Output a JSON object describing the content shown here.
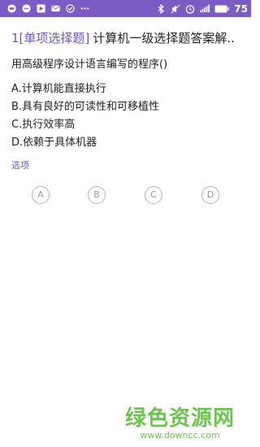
{
  "status_bar": {
    "left_icons": [
      "message-icon",
      "chat-bubble-icon",
      "play-store-icon",
      "mail-icon",
      "check-circle-icon",
      "more-icon"
    ],
    "right_icons": [
      "bluetooth-icon",
      "mute-icon",
      "alarm-icon",
      "signal-icon"
    ],
    "battery": "75"
  },
  "question": {
    "tag": "1[单项选择题]",
    "title": "计算机一级选择题答案解..",
    "stem": "用高级程序设计语言编写的程序()",
    "options": [
      "A.计算机能直接执行",
      "B.具有良好的可读性和可移植性",
      "C.执行效率高",
      "D.依赖于具体机器"
    ]
  },
  "answer_section": {
    "label": "选项",
    "choices": [
      "A",
      "B",
      "C",
      "D"
    ]
  },
  "watermark": {
    "text": "绿色资源网",
    "url": "www.downcc.com"
  },
  "colors": {
    "status_bar": "#7b5bc4",
    "accent": "#6e56c9",
    "watermark": "#5cbf3a"
  }
}
